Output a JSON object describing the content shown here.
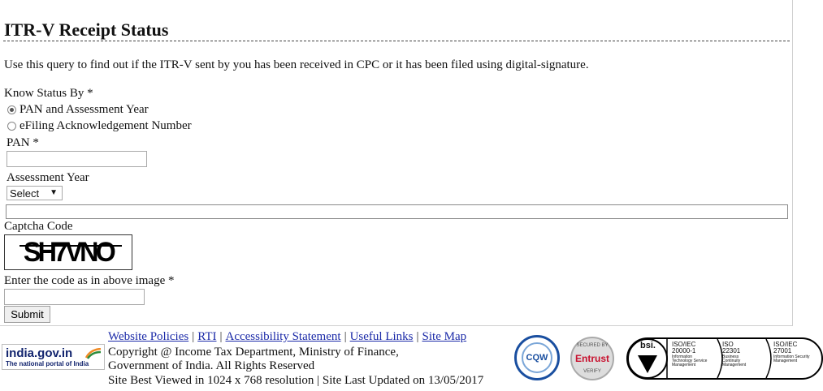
{
  "page": {
    "title": "ITR-V Receipt Status",
    "description": "Use this query to find out if the ITR-V sent by you has been received in CPC or it has been filed using digital-signature."
  },
  "form": {
    "know_status_label": "Know Status By *",
    "radio_options": [
      {
        "label": "PAN and Assessment Year",
        "selected": true
      },
      {
        "label": "eFiling Acknowledgement Number",
        "selected": false
      }
    ],
    "pan_label": "PAN *",
    "pan_value": "",
    "assessment_year_label": "Assessment Year",
    "assessment_year_selected": "Select",
    "captcha_label": "Captcha Code",
    "captcha_text": "SH7VNO",
    "captcha_input_label": "Enter the code as in above image *",
    "captcha_input_value": "",
    "submit_label": "Submit"
  },
  "footer": {
    "links": [
      "Website Policies",
      "RTI",
      "Accessibility Statement",
      "Useful Links",
      "Site Map"
    ],
    "copyright_line1": "Copyright @ Income Tax Department, Ministry of Finance,",
    "copyright_line2": "Government of India. All Rights Reserved",
    "site_info": "Site Best Viewed in 1024 x 768 resolution | Site Last Updated on 13/05/2017",
    "india_portal_main": "india.gov.in",
    "india_portal_sub": "The national portal of India",
    "stqc_label": "CQW",
    "entrust_label": "Entrust",
    "entrust_top": "SECURED BY",
    "entrust_bottom": "VERIFY",
    "bsi_label": "bsi.",
    "iso_certs": [
      {
        "code": "ISO/IEC",
        "number": "20000-1",
        "desc": [
          "Information",
          "Technology Service",
          "Management"
        ]
      },
      {
        "code": "ISO",
        "number": "22301",
        "desc": [
          "Business",
          "Continuity",
          "Management"
        ]
      },
      {
        "code": "ISO/IEC",
        "number": "27001",
        "desc": [
          "Information Security",
          "Management"
        ]
      }
    ]
  },
  "colors": {
    "link": "#1b2aa8",
    "portal_blue": "#12246e",
    "entrust_red": "#c8102e"
  }
}
